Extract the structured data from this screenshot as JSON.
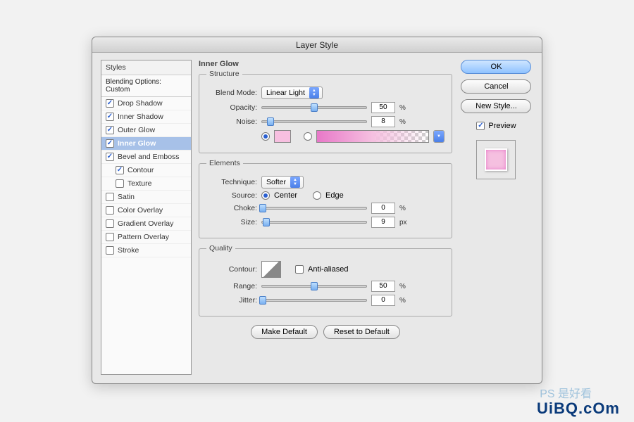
{
  "dialog": {
    "title": "Layer Style"
  },
  "sidebar": {
    "head": "Styles",
    "sub": "Blending Options: Custom",
    "items": [
      {
        "label": "Drop Shadow",
        "checked": true
      },
      {
        "label": "Inner Shadow",
        "checked": true
      },
      {
        "label": "Outer Glow",
        "checked": true
      },
      {
        "label": "Inner Glow",
        "checked": true,
        "selected": true
      },
      {
        "label": "Bevel and Emboss",
        "checked": true
      },
      {
        "label": "Contour",
        "checked": true,
        "indent": true
      },
      {
        "label": "Texture",
        "checked": false,
        "indent": true
      },
      {
        "label": "Satin",
        "checked": false
      },
      {
        "label": "Color Overlay",
        "checked": false
      },
      {
        "label": "Gradient Overlay",
        "checked": false
      },
      {
        "label": "Pattern Overlay",
        "checked": false
      },
      {
        "label": "Stroke",
        "checked": false
      }
    ]
  },
  "panel": {
    "title": "Inner Glow",
    "structure": {
      "legend": "Structure",
      "blend_mode_label": "Blend Mode:",
      "blend_mode_value": "Linear Light",
      "opacity_label": "Opacity:",
      "opacity_value": "50",
      "opacity_unit": "%",
      "noise_label": "Noise:",
      "noise_value": "8",
      "noise_unit": "%",
      "color_swatch": "#f7bfe0"
    },
    "elements": {
      "legend": "Elements",
      "technique_label": "Technique:",
      "technique_value": "Softer",
      "source_label": "Source:",
      "source_center": "Center",
      "source_edge": "Edge",
      "choke_label": "Choke:",
      "choke_value": "0",
      "choke_unit": "%",
      "size_label": "Size:",
      "size_value": "9",
      "size_unit": "px"
    },
    "quality": {
      "legend": "Quality",
      "contour_label": "Contour:",
      "antialias_label": "Anti-aliased",
      "range_label": "Range:",
      "range_value": "50",
      "range_unit": "%",
      "jitter_label": "Jitter:",
      "jitter_value": "0",
      "jitter_unit": "%"
    },
    "make_default": "Make Default",
    "reset_default": "Reset to Default"
  },
  "right": {
    "ok": "OK",
    "cancel": "Cancel",
    "new_style": "New Style...",
    "preview": "Preview"
  },
  "watermark": "UiBQ.cOm",
  "watermark2": "PS 是好看"
}
